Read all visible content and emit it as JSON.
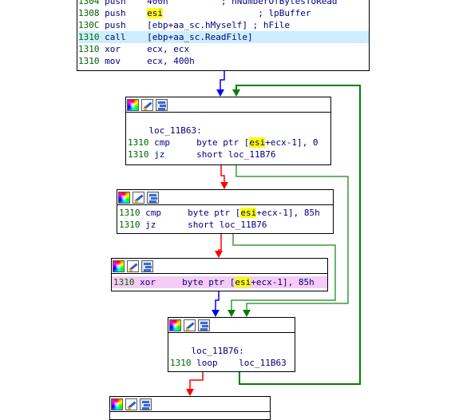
{
  "colors": {
    "address": "#006400",
    "text": "#000080",
    "highlight": "#ffff00",
    "current_line": "#cceeff",
    "pink_line": "#f5ccf5",
    "edge_true": "#008000",
    "edge_false": "#ff0000",
    "edge_uncond": "#0000ff"
  },
  "toolbar_icons": [
    "color-palette-icon",
    "edit-pen-icon",
    "graph-view-icon"
  ],
  "block1": {
    "lines": [
      {
        "addr": "1304",
        "mnem": "push",
        "op_a": "400h",
        "op_hl": "",
        "op_b": "",
        "comment": "; nNumberOfBytesToRead"
      },
      {
        "addr": "1308",
        "mnem": "push",
        "op_a": "",
        "op_hl": "esi",
        "op_b": "",
        "comment": "; lpBuffer"
      },
      {
        "addr": "130C",
        "mnem": "push",
        "op_a": "[ebp+aa_sc.hMyself]",
        "op_hl": "",
        "op_b": "",
        "comment": "; hFile"
      },
      {
        "addr": "1310",
        "mnem": "call",
        "op_a": "[ebp+aa_sc.ReadFile]",
        "op_hl": "",
        "op_b": "",
        "comment": ""
      },
      {
        "addr": "1310",
        "mnem": "xor",
        "op_a": "ecx, ecx",
        "op_hl": "",
        "op_b": "",
        "comment": ""
      },
      {
        "addr": "1310",
        "mnem": "mov",
        "op_a": "ecx, 400h",
        "op_hl": "",
        "op_b": "",
        "comment": ""
      }
    ]
  },
  "block2": {
    "label": "loc_11B63:",
    "lines": [
      {
        "addr": "1310",
        "mnem": "cmp",
        "op_a": "byte ptr [",
        "op_hl": "esi",
        "op_b": "+ecx-1], 0"
      },
      {
        "addr": "1310",
        "mnem": "jz",
        "op_a": "short loc_11B76",
        "op_hl": "",
        "op_b": ""
      }
    ]
  },
  "block3": {
    "lines": [
      {
        "addr": "1310",
        "mnem": "cmp",
        "op_a": "byte ptr [",
        "op_hl": "esi",
        "op_b": "+ecx-1], 85h"
      },
      {
        "addr": "1310",
        "mnem": "jz",
        "op_a": "short loc_11B76",
        "op_hl": "",
        "op_b": ""
      }
    ]
  },
  "block4": {
    "lines": [
      {
        "addr": "1310",
        "mnem": "xor",
        "op_a": "byte ptr [",
        "op_hl": "esi",
        "op_b": "+ecx-1], 85h"
      }
    ]
  },
  "block5": {
    "label": "loc_11B76:",
    "lines": [
      {
        "addr": "1310",
        "mnem": "loop",
        "op_a": "loc_11B63",
        "op_hl": "",
        "op_b": ""
      }
    ]
  }
}
